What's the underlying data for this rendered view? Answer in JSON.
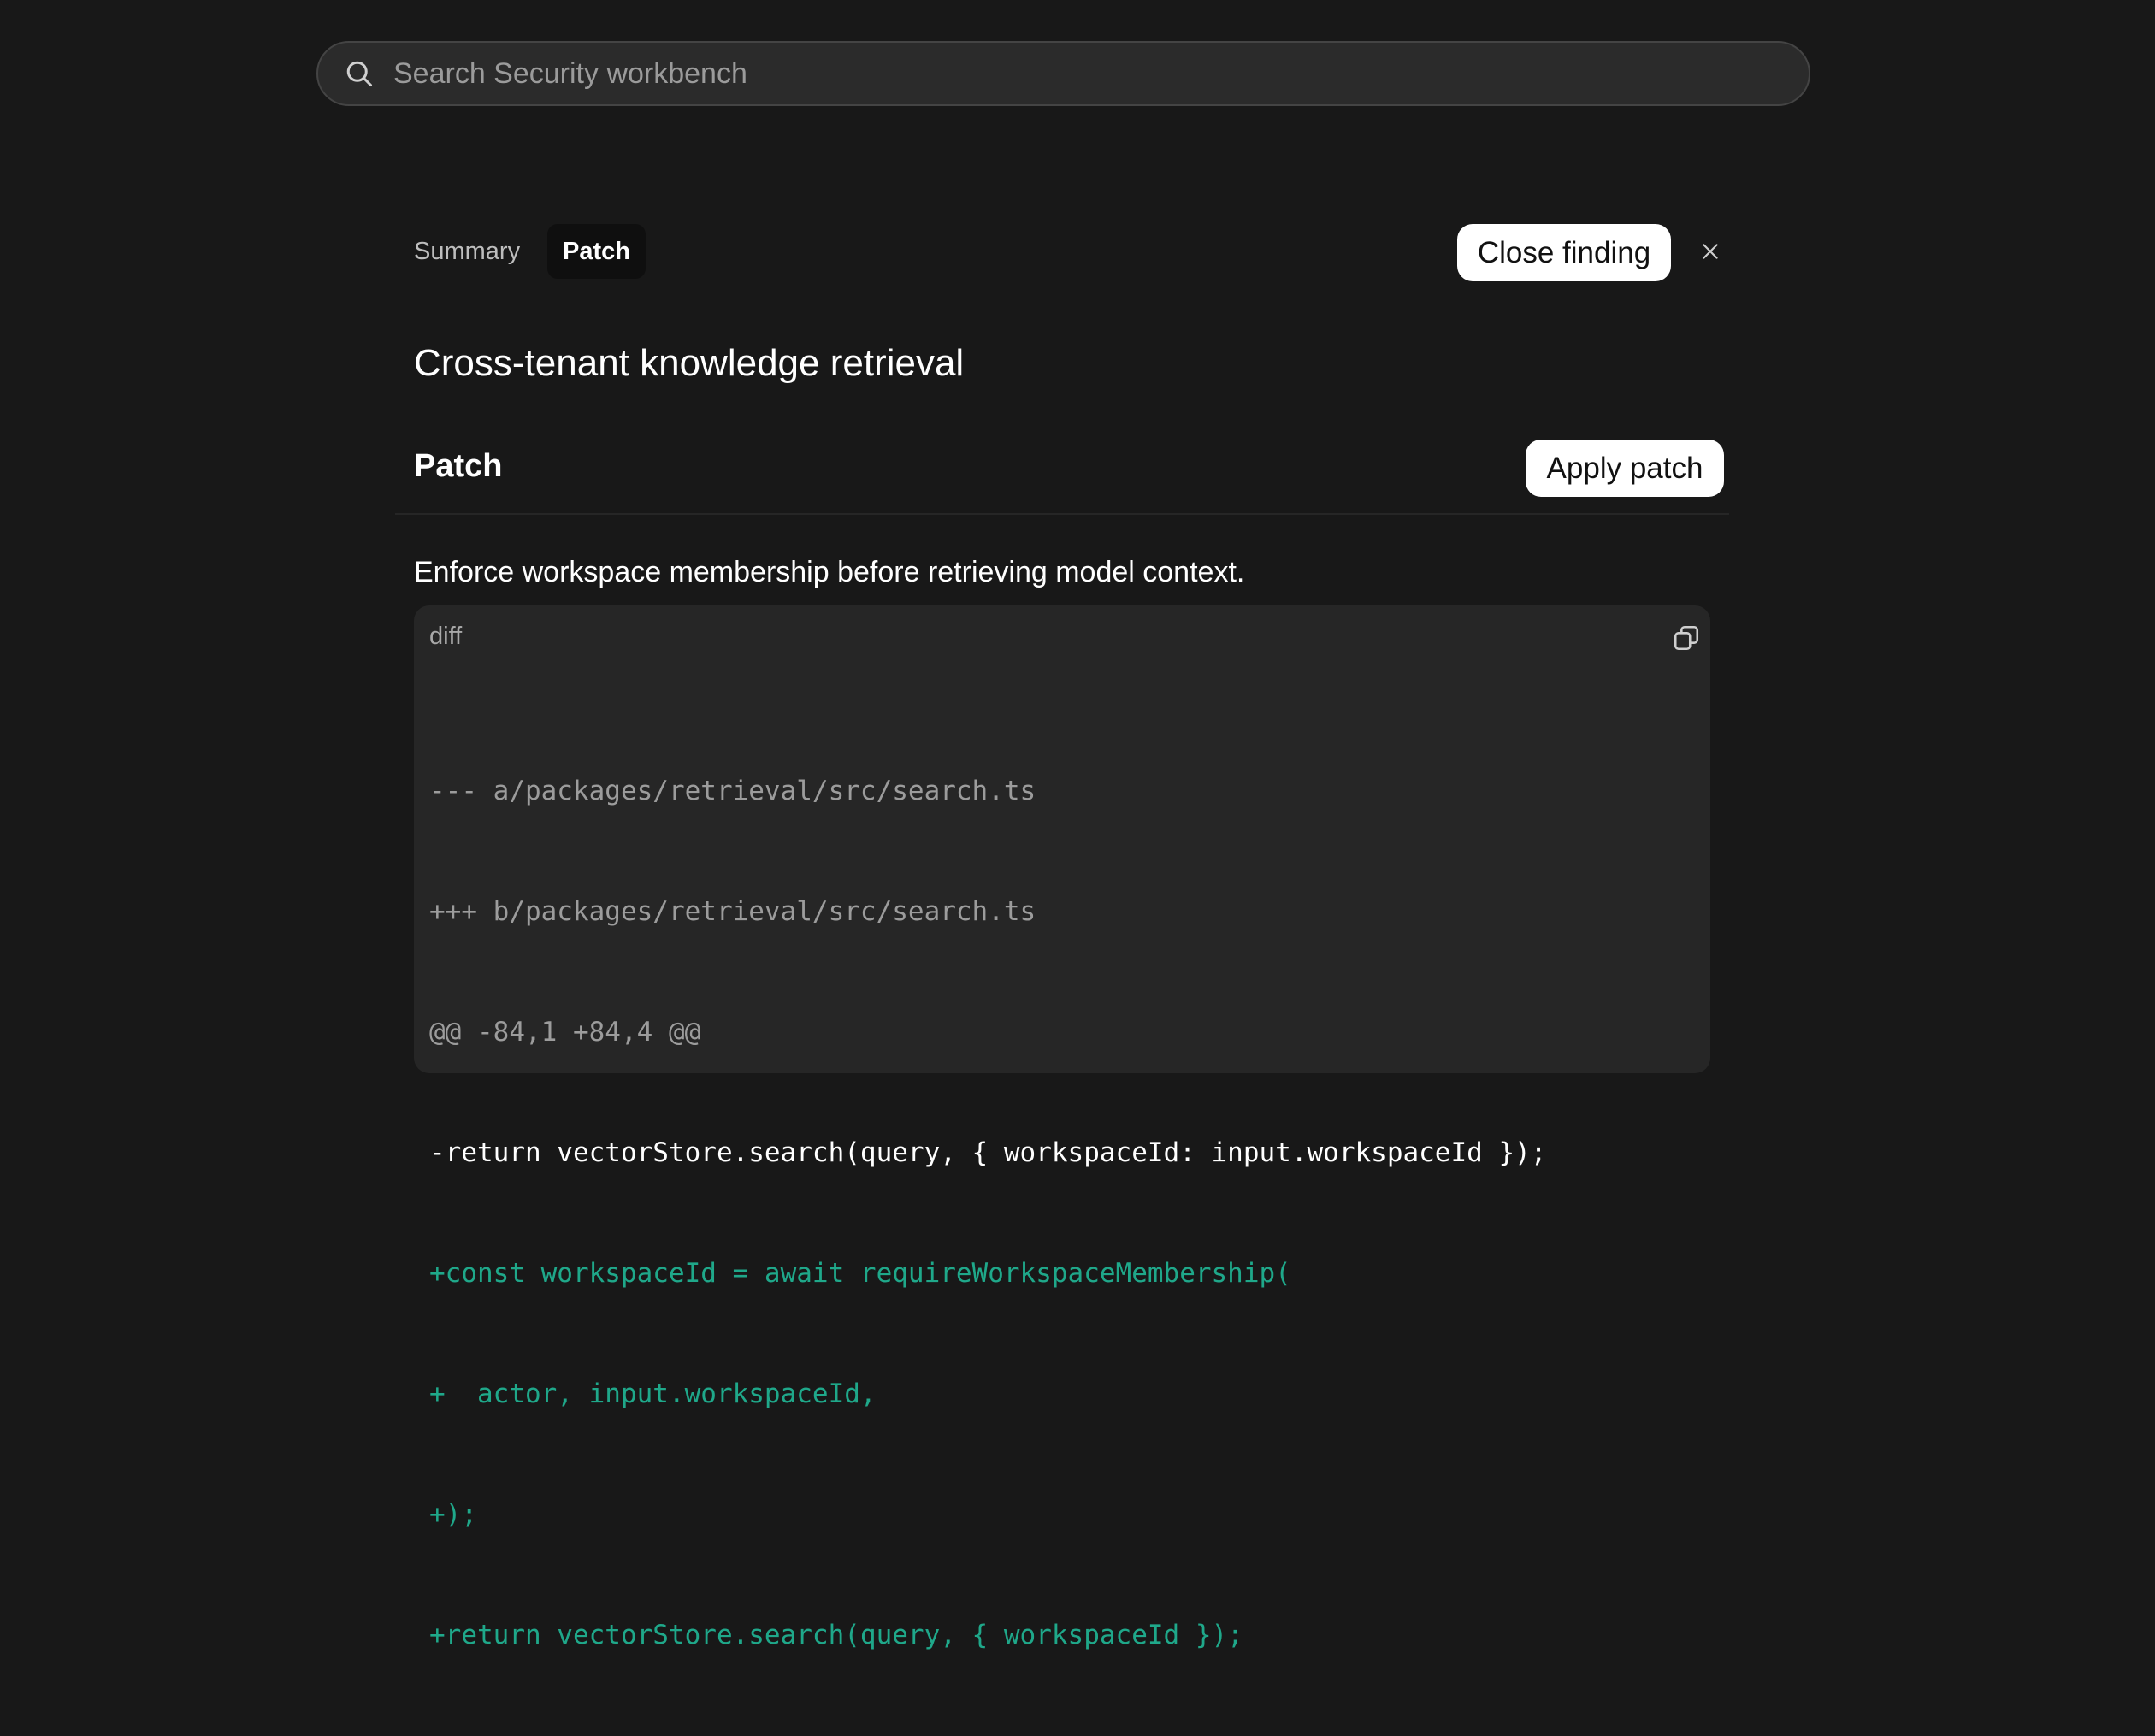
{
  "search": {
    "placeholder": "Search Security workbench"
  },
  "tabs": [
    {
      "label": "Summary",
      "active": false
    },
    {
      "label": "Patch",
      "active": true
    }
  ],
  "header": {
    "close_finding_label": "Close finding"
  },
  "finding": {
    "title": "Cross-tenant knowledge retrieval"
  },
  "patch_section": {
    "title": "Patch",
    "apply_label": "Apply patch",
    "description": "Enforce workspace membership before retrieving model context.",
    "code": {
      "language": "diff",
      "lines": [
        {
          "type": "meta",
          "text": "--- a/packages/retrieval/src/search.ts"
        },
        {
          "type": "meta",
          "text": "+++ b/packages/retrieval/src/search.ts"
        },
        {
          "type": "meta",
          "text": "@@ -84,1 +84,4 @@"
        },
        {
          "type": "del",
          "text": "-return vectorStore.search(query, { workspaceId: input.workspaceId });"
        },
        {
          "type": "add",
          "text": "+const workspaceId = await requireWorkspaceMembership("
        },
        {
          "type": "add",
          "text": "+  actor, input.workspaceId,"
        },
        {
          "type": "add",
          "text": "+);"
        },
        {
          "type": "add",
          "text": "+return vectorStore.search(query, { workspaceId });"
        }
      ]
    }
  },
  "icons": {
    "search": "search-icon",
    "close": "close-icon",
    "copy": "copy-icon"
  },
  "colors": {
    "background": "#181818",
    "diff_added": "#1fa88a",
    "diff_meta": "#9c9c9c"
  }
}
